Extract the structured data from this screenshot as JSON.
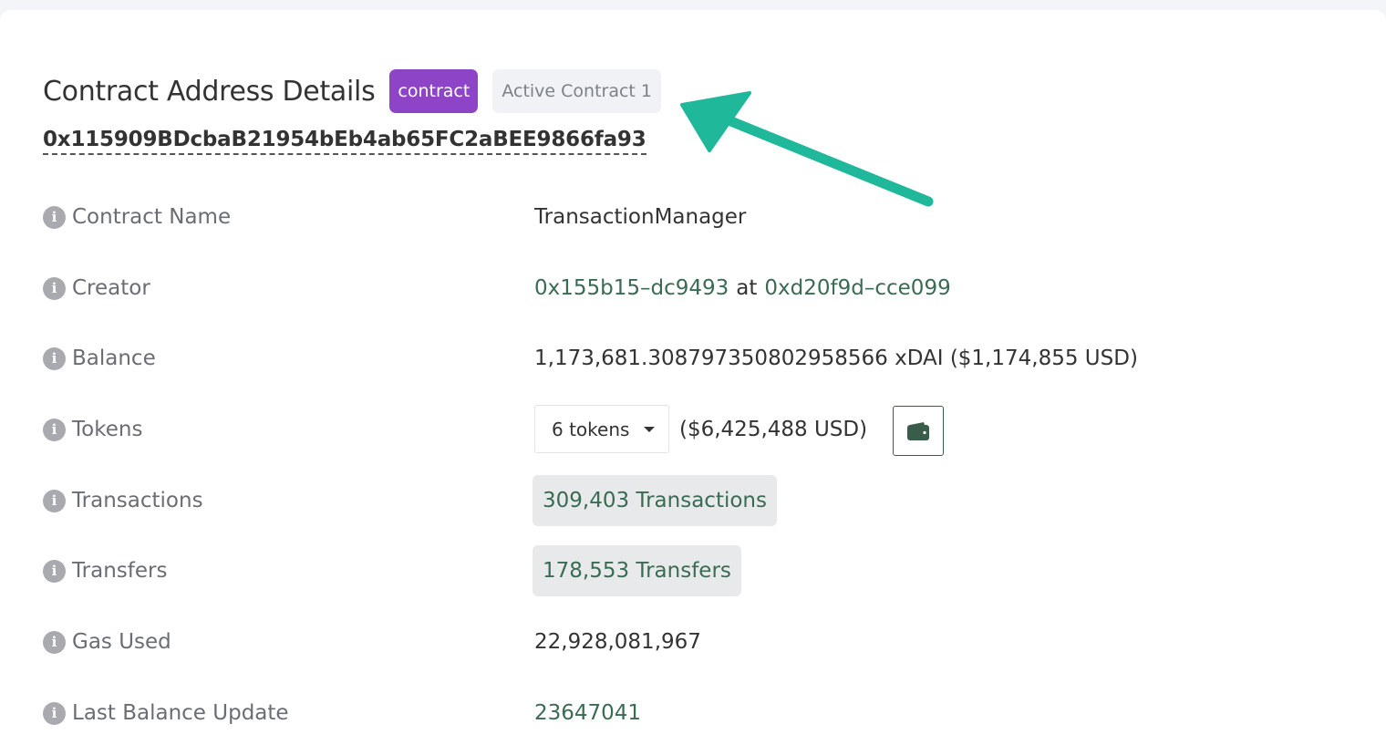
{
  "header": {
    "title": "Contract Address Details",
    "badge_type": "contract",
    "badge_active": "Active Contract 1",
    "address": "0x115909BDcbaB21954bEb4ab65FC2aBEE9866fa93"
  },
  "details": {
    "contract_name": {
      "label": "Contract Name",
      "value": "TransactionManager"
    },
    "creator": {
      "label": "Creator",
      "address": "0x155b15–dc9493",
      "at": "at",
      "tx": "0xd20f9d–cce099"
    },
    "balance": {
      "label": "Balance",
      "value": "1,173,681.308797350802958566 xDAI ($1,174,855 USD)"
    },
    "tokens": {
      "label": "Tokens",
      "dropdown": "6 tokens",
      "usd": "($6,425,488 USD)"
    },
    "transactions": {
      "label": "Transactions",
      "value": "309,403 Transactions"
    },
    "transfers": {
      "label": "Transfers",
      "value": "178,553 Transfers"
    },
    "gas_used": {
      "label": "Gas Used",
      "value": "22,928,081,967"
    },
    "last_balance_update": {
      "label": "Last Balance Update",
      "value": "23647041"
    }
  },
  "icons": {
    "info": "i",
    "wallet": "wallet-icon",
    "caret": "chevron-down-icon",
    "annotation": "arrow-annotation"
  },
  "colors": {
    "purple_badge": "#8e44c6",
    "link_green": "#3a6b53",
    "annotation_arrow": "#1fb89a"
  }
}
